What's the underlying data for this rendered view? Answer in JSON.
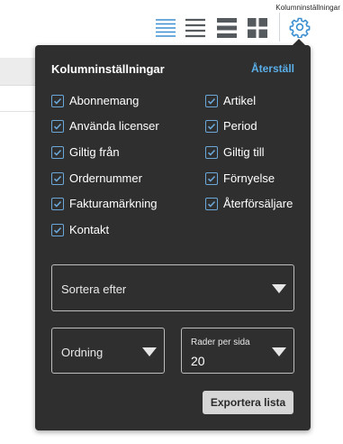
{
  "tooltip": {
    "text": "Kolumninställningar"
  },
  "toolbar": {
    "icons": [
      "list-compact-icon",
      "list-icon",
      "list-wide-icon",
      "grid-icon",
      "gear-icon"
    ],
    "active_color": "#3b8fd1",
    "inactive_color": "#555a5f"
  },
  "panel": {
    "title": "Kolumninställningar",
    "reset_label": "Återställ",
    "columns": [
      {
        "label": "Abonnemang",
        "checked": true
      },
      {
        "label": "Artikel",
        "checked": true
      },
      {
        "label": "Använda licenser",
        "checked": true
      },
      {
        "label": "Period",
        "checked": true
      },
      {
        "label": "Giltig från",
        "checked": true
      },
      {
        "label": "Giltig till",
        "checked": true
      },
      {
        "label": "Ordernummer",
        "checked": true
      },
      {
        "label": "Förnyelse",
        "checked": true
      },
      {
        "label": "Fakturamärkning",
        "checked": true
      },
      {
        "label": "Återförsäljare",
        "checked": true
      },
      {
        "label": "Kontakt",
        "checked": true
      }
    ],
    "sort": {
      "placeholder": "Sortera efter"
    },
    "order": {
      "placeholder": "Ordning"
    },
    "rows_per_page": {
      "label": "Rader per sida",
      "value": "20"
    },
    "export_label": "Exportera lista"
  },
  "colors": {
    "panel_bg": "#2f2f2f",
    "accent": "#5aaee8",
    "checkbox_border": "#6ba7d8"
  }
}
